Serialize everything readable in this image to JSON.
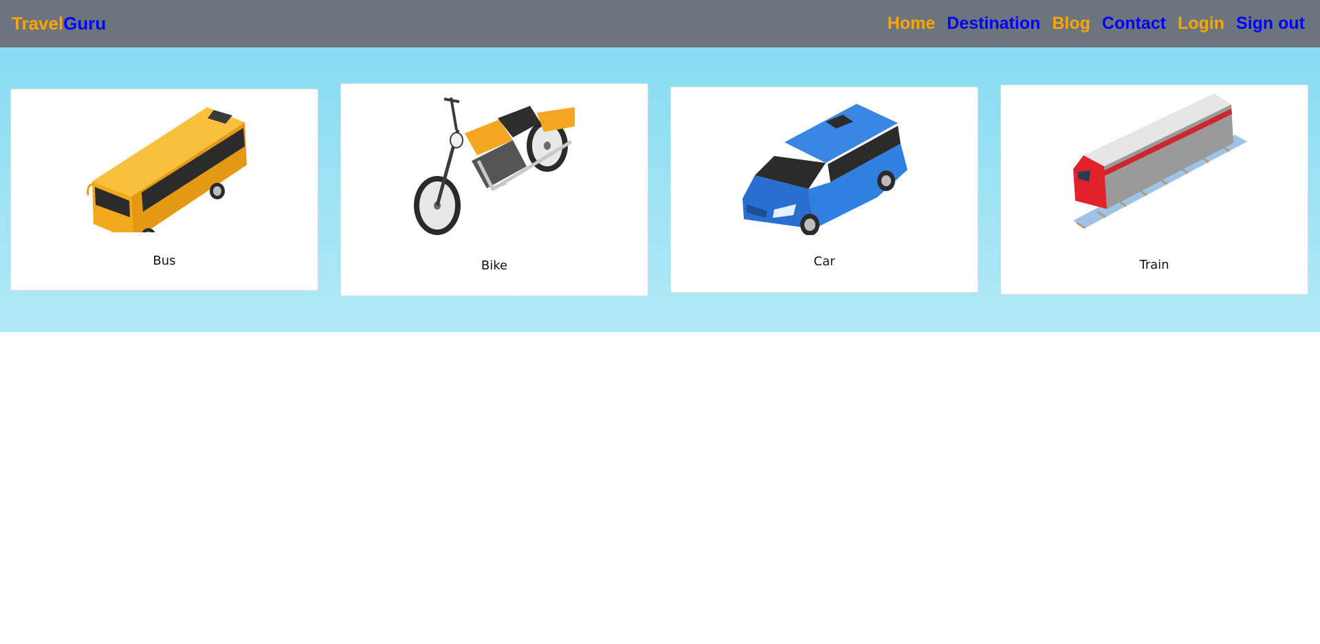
{
  "navbar": {
    "brand_part1": "Travel",
    "brand_part2": "Guru",
    "links": [
      {
        "label": "Home",
        "color": "#ffa500"
      },
      {
        "label": "Destination",
        "color": "#0000ff"
      },
      {
        "label": "Blog",
        "color": "#ffa500"
      },
      {
        "label": "Contact",
        "color": "#0000ff"
      },
      {
        "label": "Login",
        "color": "#ffa500"
      },
      {
        "label": "Sign out",
        "color": "#0000ff"
      }
    ],
    "background": "#6c757d"
  },
  "hero": {
    "gradient_top": "#87dcf2",
    "gradient_bottom": "#b2e9f6"
  },
  "vehicles": [
    {
      "label": "Bus",
      "icon": "bus-icon",
      "color": "#f9b526"
    },
    {
      "label": "Bike",
      "icon": "motorcycle-icon",
      "color": "#f4a621"
    },
    {
      "label": "Car",
      "icon": "car-icon",
      "color": "#2f80e0"
    },
    {
      "label": "Train",
      "icon": "train-icon",
      "color": "#e0232b"
    }
  ]
}
